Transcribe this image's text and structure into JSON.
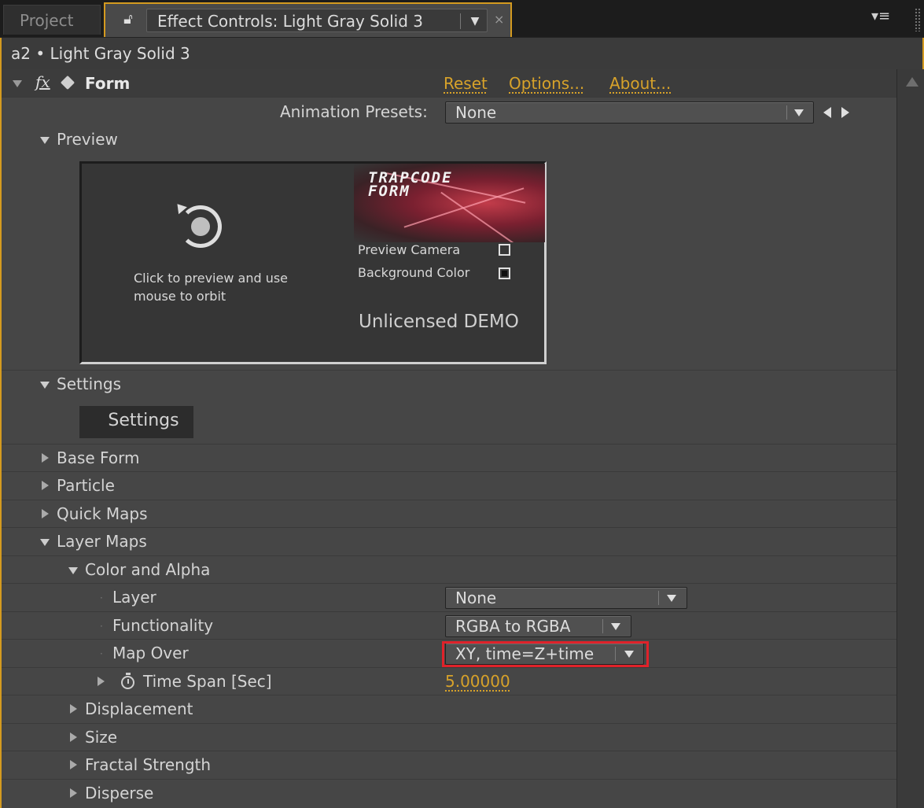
{
  "tabs": {
    "project": "Project",
    "effect_controls": "Effect Controls: Light Gray Solid 3"
  },
  "layer_path": "a2 • Light Gray Solid 3",
  "effect": {
    "name": "Form",
    "links": {
      "reset": "Reset",
      "options": "Options...",
      "about": "About..."
    },
    "animation_presets_label": "Animation Presets:",
    "animation_presets_value": "None"
  },
  "preview": {
    "section_label": "Preview",
    "hint": "Click to preview and use mouse to orbit",
    "logo_text_line1": "TRAPCODE",
    "logo_text_line2": "FORM",
    "preview_camera_label": "Preview Camera",
    "background_color_label": "Background Color",
    "demo_label": "Unlicensed DEMO"
  },
  "settings": {
    "section_label": "Settings",
    "button_label": "Settings"
  },
  "groups": {
    "base_form": "Base Form",
    "particle": "Particle",
    "quick_maps": "Quick Maps",
    "layer_maps": "Layer Maps",
    "color_and_alpha": "Color and Alpha",
    "displacement": "Displacement",
    "size": "Size",
    "fractal_strength": "Fractal Strength",
    "disperse": "Disperse"
  },
  "properties": {
    "layer": {
      "label": "Layer",
      "value": "None"
    },
    "functionality": {
      "label": "Functionality",
      "value": "RGBA to RGBA"
    },
    "map_over": {
      "label": "Map Over",
      "value": "XY, time=Z+time"
    },
    "time_span": {
      "label": "Time Span [Sec]",
      "value": "5.00000"
    }
  },
  "colors": {
    "accent": "#d49a1f",
    "link": "#d7a22a",
    "highlight": "#e0222a"
  }
}
